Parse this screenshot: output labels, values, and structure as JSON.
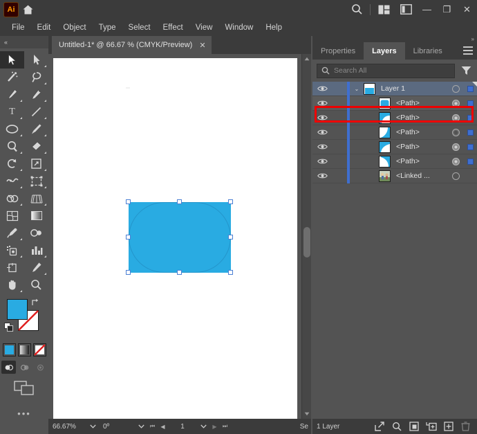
{
  "app": {
    "name": "Adobe Illustrator",
    "logo_text": "Ai",
    "logo_icon": "illustrator-logo-icon",
    "home_icon": "home-icon",
    "search_icon": "search-icon",
    "arrange_icon": "arrange-documents-icon",
    "workspace_icon": "workspace-switcher-icon"
  },
  "window_controls": {
    "minimize": "—",
    "maximize": "❐",
    "close": "✕"
  },
  "menubar": {
    "items": [
      {
        "label": "File"
      },
      {
        "label": "Edit"
      },
      {
        "label": "Object"
      },
      {
        "label": "Type"
      },
      {
        "label": "Select"
      },
      {
        "label": "Effect"
      },
      {
        "label": "View"
      },
      {
        "label": "Window"
      },
      {
        "label": "Help"
      }
    ]
  },
  "toolbar": {
    "collapse_label": "«",
    "tools": [
      {
        "name": "selection-tool",
        "label": "Selection",
        "selected": true
      },
      {
        "name": "direct-selection-tool",
        "label": "Direct Selection",
        "selected": false
      },
      {
        "name": "magic-wand-tool",
        "label": "Magic Wand",
        "selected": false
      },
      {
        "name": "lasso-tool",
        "label": "Lasso",
        "selected": false
      },
      {
        "name": "pen-tool",
        "label": "Pen",
        "selected": false
      },
      {
        "name": "curvature-tool",
        "label": "Curvature",
        "selected": false
      },
      {
        "name": "type-tool",
        "label": "Type",
        "selected": false
      },
      {
        "name": "line-segment-tool",
        "label": "Line Segment",
        "selected": false
      },
      {
        "name": "ellipse-tool",
        "label": "Ellipse",
        "selected": false
      },
      {
        "name": "paintbrush-tool",
        "label": "Paintbrush",
        "selected": false
      },
      {
        "name": "shaper-tool",
        "label": "Shaper",
        "selected": false
      },
      {
        "name": "eraser-tool",
        "label": "Eraser",
        "selected": false
      },
      {
        "name": "rotate-tool",
        "label": "Rotate",
        "selected": false
      },
      {
        "name": "scale-tool",
        "label": "Scale",
        "selected": false
      },
      {
        "name": "width-tool",
        "label": "Width",
        "selected": false
      },
      {
        "name": "free-transform-tool",
        "label": "Free Transform",
        "selected": false
      },
      {
        "name": "shape-builder-tool",
        "label": "Shape Builder",
        "selected": false
      },
      {
        "name": "perspective-grid-tool",
        "label": "Perspective Grid",
        "selected": false
      },
      {
        "name": "mesh-tool",
        "label": "Mesh",
        "selected": false
      },
      {
        "name": "gradient-tool",
        "label": "Gradient",
        "selected": false
      },
      {
        "name": "eyedropper-tool",
        "label": "Eyedropper",
        "selected": false
      },
      {
        "name": "blend-tool",
        "label": "Blend",
        "selected": false
      },
      {
        "name": "symbol-sprayer-tool",
        "label": "Symbol Sprayer",
        "selected": false
      },
      {
        "name": "column-graph-tool",
        "label": "Column Graph",
        "selected": false
      },
      {
        "name": "artboard-tool",
        "label": "Artboard",
        "selected": false
      },
      {
        "name": "slice-tool",
        "label": "Slice",
        "selected": false
      },
      {
        "name": "hand-tool",
        "label": "Hand",
        "selected": false
      },
      {
        "name": "zoom-tool",
        "label": "Zoom",
        "selected": false
      }
    ],
    "fill_color": "#29abe2",
    "stroke_color": "#ffffff",
    "stroke_is_none": true,
    "swap_icon": "swap-fill-stroke-icon",
    "default_icon": "default-fill-stroke-icon",
    "modes": [
      {
        "name": "color-mode",
        "label": "Color"
      },
      {
        "name": "gradient-mode",
        "label": "Gradient"
      },
      {
        "name": "none-mode",
        "label": "None"
      }
    ],
    "draw_modes": [
      {
        "name": "draw-normal",
        "label": "Draw Normal",
        "selected": true
      },
      {
        "name": "draw-behind",
        "label": "Draw Behind",
        "selected": false
      },
      {
        "name": "draw-inside",
        "label": "Draw Inside",
        "selected": false
      }
    ],
    "screen_mode": "change-screen-mode-icon",
    "more_tools": "•••"
  },
  "document_tab": {
    "title": "Untitled-1* @ 66.67 % (CMYK/Preview)",
    "close": "✕"
  },
  "canvas": {
    "artboard_bg": "#ffffff",
    "shape": {
      "name": "selected-rectangle",
      "fill": "#29abe2",
      "handle_fill": "#ffffff",
      "handle_border": "#4a7fd4"
    },
    "scrollbar": {
      "up_arrow": "▲",
      "down_arrow": "▼"
    }
  },
  "statusbar": {
    "zoom": "66.67%",
    "rotation": "0º",
    "page": "1",
    "first_label": "⏮",
    "prev_label": "◀",
    "next_label": "▶",
    "last_label": "⏭",
    "status_text": "Se",
    "dropdown": "⌄"
  },
  "panels": {
    "expand_icon": "»",
    "tabs": [
      {
        "label": "Properties",
        "name": "tab-properties",
        "active": false
      },
      {
        "label": "Layers",
        "name": "tab-layers",
        "active": true
      },
      {
        "label": "Libraries",
        "name": "tab-libraries",
        "active": false
      }
    ],
    "menu_icon": "panel-menu-icon",
    "search": {
      "placeholder": "Search All",
      "value": "",
      "icon": "search-icon",
      "filter_icon": "filter-icon"
    },
    "layers": {
      "rows": [
        {
          "name": "Layer 1",
          "type": "layer",
          "thumb": "layer-thumb",
          "visible": true,
          "expanded": true,
          "twisty": "⌄",
          "target_filled": false,
          "has_selbox": true,
          "selected": false,
          "highlighted": false
        },
        {
          "name": "<Path>",
          "type": "path",
          "thumb": "rect-thumb",
          "visible": true,
          "target_filled": true,
          "has_selbox": true,
          "selected": true,
          "highlighted": true
        },
        {
          "name": "<Path>",
          "type": "path",
          "thumb": "curve-thumb-a",
          "visible": true,
          "target_filled": true,
          "has_selbox": true,
          "selected": false,
          "highlighted": false
        },
        {
          "name": "<Path>",
          "type": "path",
          "thumb": "curve-thumb-b",
          "visible": true,
          "target_filled": false,
          "has_selbox": true,
          "selected": false,
          "highlighted": false
        },
        {
          "name": "<Path>",
          "type": "path",
          "thumb": "curve-thumb-c",
          "visible": true,
          "target_filled": true,
          "has_selbox": true,
          "selected": false,
          "highlighted": false
        },
        {
          "name": "<Path>",
          "type": "path",
          "thumb": "curve-thumb-d",
          "visible": true,
          "target_filled": true,
          "has_selbox": true,
          "selected": false,
          "highlighted": false
        },
        {
          "name": "<Linked ...",
          "type": "linked",
          "thumb": "linked-image-thumb",
          "visible": true,
          "target_filled": false,
          "has_selbox": false,
          "selected": false,
          "highlighted": false
        }
      ],
      "footer": {
        "count_label": "1 Layer",
        "icons": [
          {
            "name": "locate-object-icon",
            "label": "Locate Object"
          },
          {
            "name": "search-layer-icon",
            "label": "Search"
          },
          {
            "name": "make-clipping-mask-icon",
            "label": "Make/Release Clipping Mask"
          },
          {
            "name": "create-new-sublayer-icon",
            "label": "Create New Sublayer"
          },
          {
            "name": "create-new-layer-icon",
            "label": "Create New Layer"
          },
          {
            "name": "delete-selection-icon",
            "label": "Delete Selection"
          }
        ]
      }
    }
  },
  "annotation": {
    "name": "red-highlight-box",
    "color": "#ee0000"
  }
}
